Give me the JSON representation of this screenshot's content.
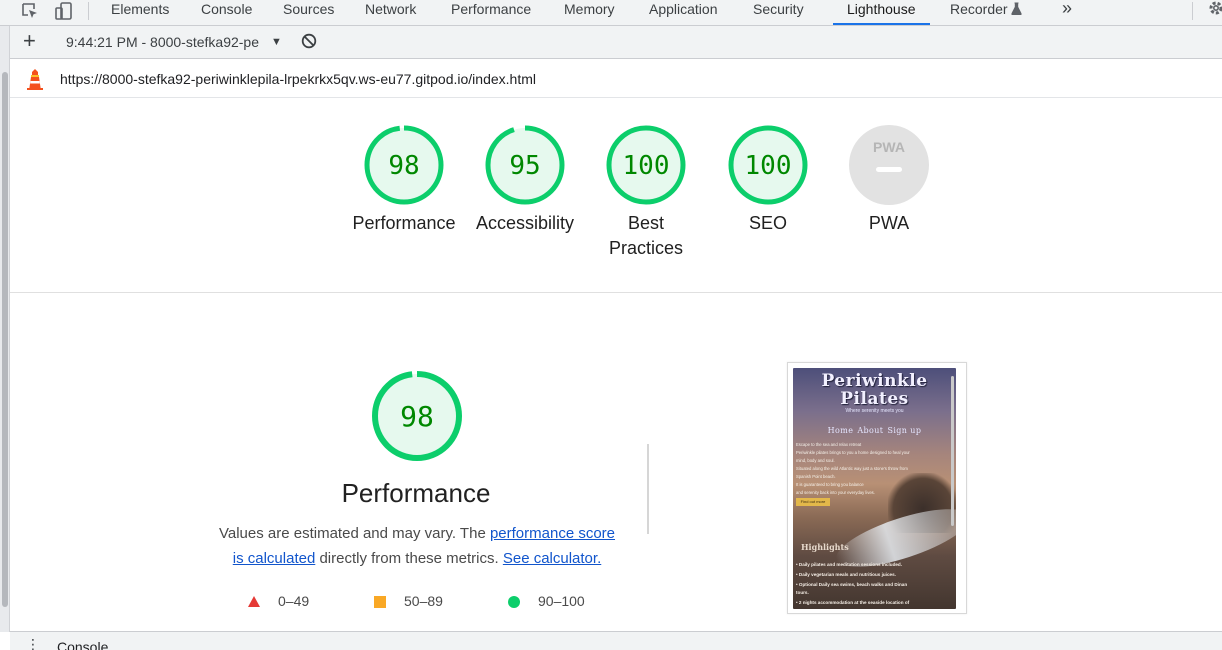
{
  "devtools": {
    "tabs": [
      "Elements",
      "Console",
      "Sources",
      "Network",
      "Performance",
      "Memory",
      "Application",
      "Security",
      "Lighthouse",
      "Recorder"
    ],
    "active_tab": "Lighthouse",
    "more_label": "»"
  },
  "toolbar": {
    "report_label": "9:44:21 PM - 8000-stefka92-pe",
    "new_report_icon": "plus-icon",
    "clear_icon": "block-icon"
  },
  "url_bar": {
    "url": "https://8000-stefka92-periwinklepila-lrpekrkx5qv.ws-eu77.gitpod.io/index.html",
    "logo_icon": "lighthouse-icon"
  },
  "gauges": [
    {
      "score": 98,
      "label_line1": "Performance",
      "label_line2": ""
    },
    {
      "score": 95,
      "label_line1": "Accessibility",
      "label_line2": ""
    },
    {
      "score": 100,
      "label_line1": "Best",
      "label_line2": "Practices"
    },
    {
      "score": 100,
      "label_line1": "SEO",
      "label_line2": ""
    },
    {
      "score": null,
      "label_line1": "PWA",
      "label_line2": "",
      "badge": "PWA"
    }
  ],
  "performance": {
    "score": 98,
    "title": "Performance",
    "desc_prefix": "Values are estimated and may vary. The ",
    "desc_link1a": "performance score",
    "desc_link1b": "is calculated",
    "desc_middle": " directly from these metrics. ",
    "desc_link2": "See calculator.",
    "legend": [
      {
        "range": "0–49",
        "shape": "triangle",
        "color": "#e53935"
      },
      {
        "range": "50–89",
        "shape": "square",
        "color": "#f9a825"
      },
      {
        "range": "90–100",
        "shape": "circle",
        "color": "#0cce6b"
      }
    ]
  },
  "screenshot": {
    "title_line1": "Periwinkle",
    "title_line2": "Pilates",
    "tagline": "Where serenity meets you",
    "nav": [
      "Home",
      "About",
      "Sign up"
    ],
    "paragraph_lines": [
      "Escape to the sea and relax retreat",
      "Periwinkle pilates brings to you a home designed to heal your",
      "mind, body and soul.",
      "Situated along the wild Atlantic way just a stone's throw from",
      "Spanish Point beach.",
      "It is guaranteed to bring you balance",
      "and serenity back into your everyday lives."
    ],
    "button": "Find out more",
    "highlights_title": "Highlights",
    "bullets": [
      "• Daily pilates and meditation sessions included.",
      "• Daily vegetarian meals and nutritious juices.",
      "• Optional Daily sea swims, beach walks and Dinan",
      "  tours.",
      "• 2 nights accommodation at the seaside location of"
    ]
  },
  "drawer": {
    "tab": "Console"
  },
  "colors": {
    "pass": "#0cce6b",
    "pass_text": "#008800",
    "accent": "#1a73e8"
  }
}
